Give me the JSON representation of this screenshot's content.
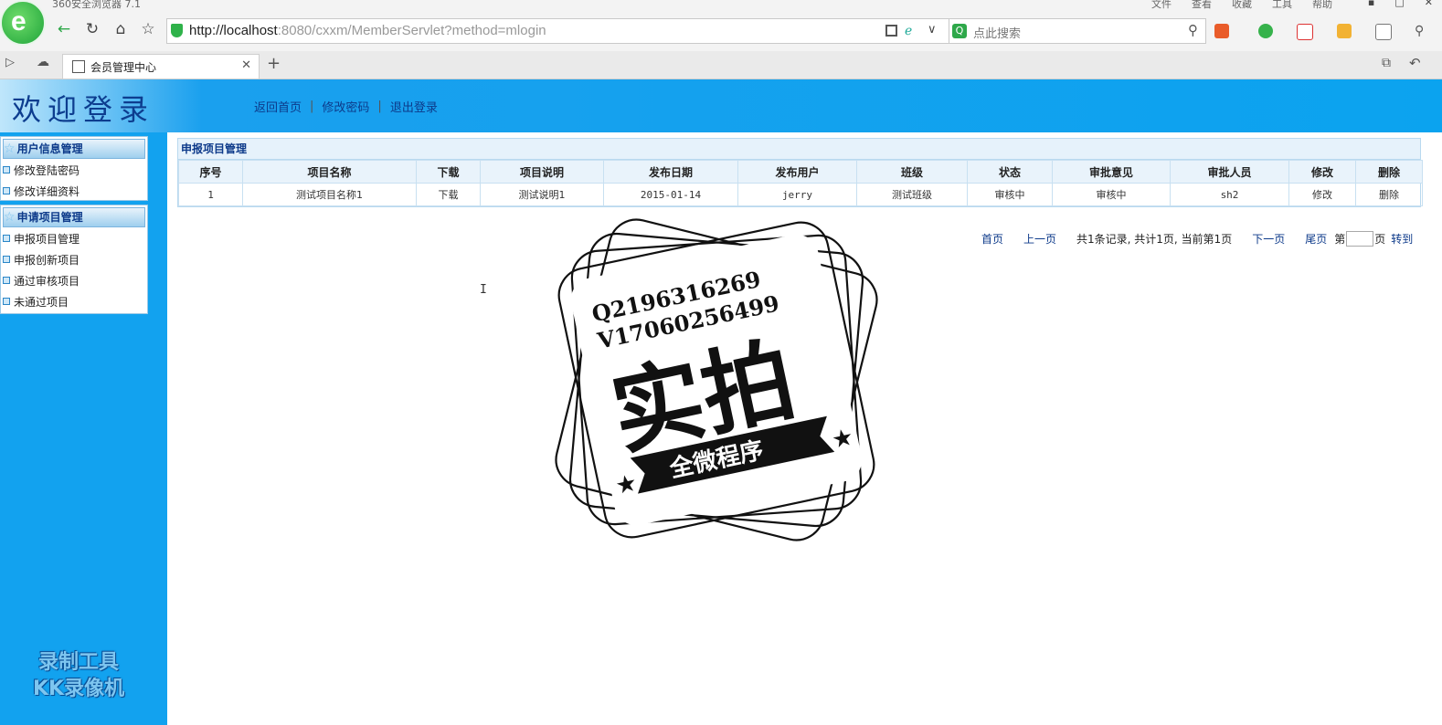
{
  "browser": {
    "app_title": "360安全浏览器 7.1",
    "menus": [
      "文件",
      "查看",
      "收藏",
      "工具",
      "帮助"
    ],
    "url_host": "http://localhost",
    "url_rest": ":8080/cxxm/MemberServlet?method=mlogin",
    "search_placeholder": "点此搜索",
    "tab_title": "会员管理中心",
    "logo_letter": "e",
    "accent": "#2fb24a"
  },
  "header": {
    "title": "欢迎登录",
    "links": [
      "返回首页",
      "修改密码",
      "退出登录"
    ],
    "separator": "|",
    "color": "#0ba3ef"
  },
  "sidebar": {
    "groups": [
      {
        "title": "用户信息管理",
        "items": [
          "修改登陆密码",
          "修改详细资料"
        ]
      },
      {
        "title": "申请项目管理",
        "items": [
          "申报项目管理",
          "申报创新项目",
          "通过审核项目",
          "未通过项目"
        ]
      }
    ],
    "watermark_line1": "录制工具",
    "watermark_line2": "KK录像机"
  },
  "main": {
    "panel_title": "申报项目管理",
    "columns": [
      "序号",
      "项目名称",
      "下载",
      "项目说明",
      "发布日期",
      "发布用户",
      "班级",
      "状态",
      "审批意见",
      "审批人员",
      "修改",
      "删除"
    ],
    "rows": [
      [
        "1",
        "测试项目名称1",
        "下载",
        "测试说明1",
        "2015-01-14",
        "jerry",
        "测试班级",
        "审核中",
        "审核中",
        "sh2",
        "修改",
        "删除"
      ]
    ],
    "pager": {
      "first": "首页",
      "prev": "上一页",
      "info": "共1条记录, 共计1页, 当前第1页",
      "next": "下一页",
      "last": "尾页",
      "goto_prefix": "第",
      "goto_suffix": "页",
      "goto_button": "转到",
      "page_input": ""
    }
  },
  "stamp": {
    "line1": "Q2196316269",
    "line2": "V17060256499",
    "big": "实拍",
    "ribbon": "全微程序"
  }
}
